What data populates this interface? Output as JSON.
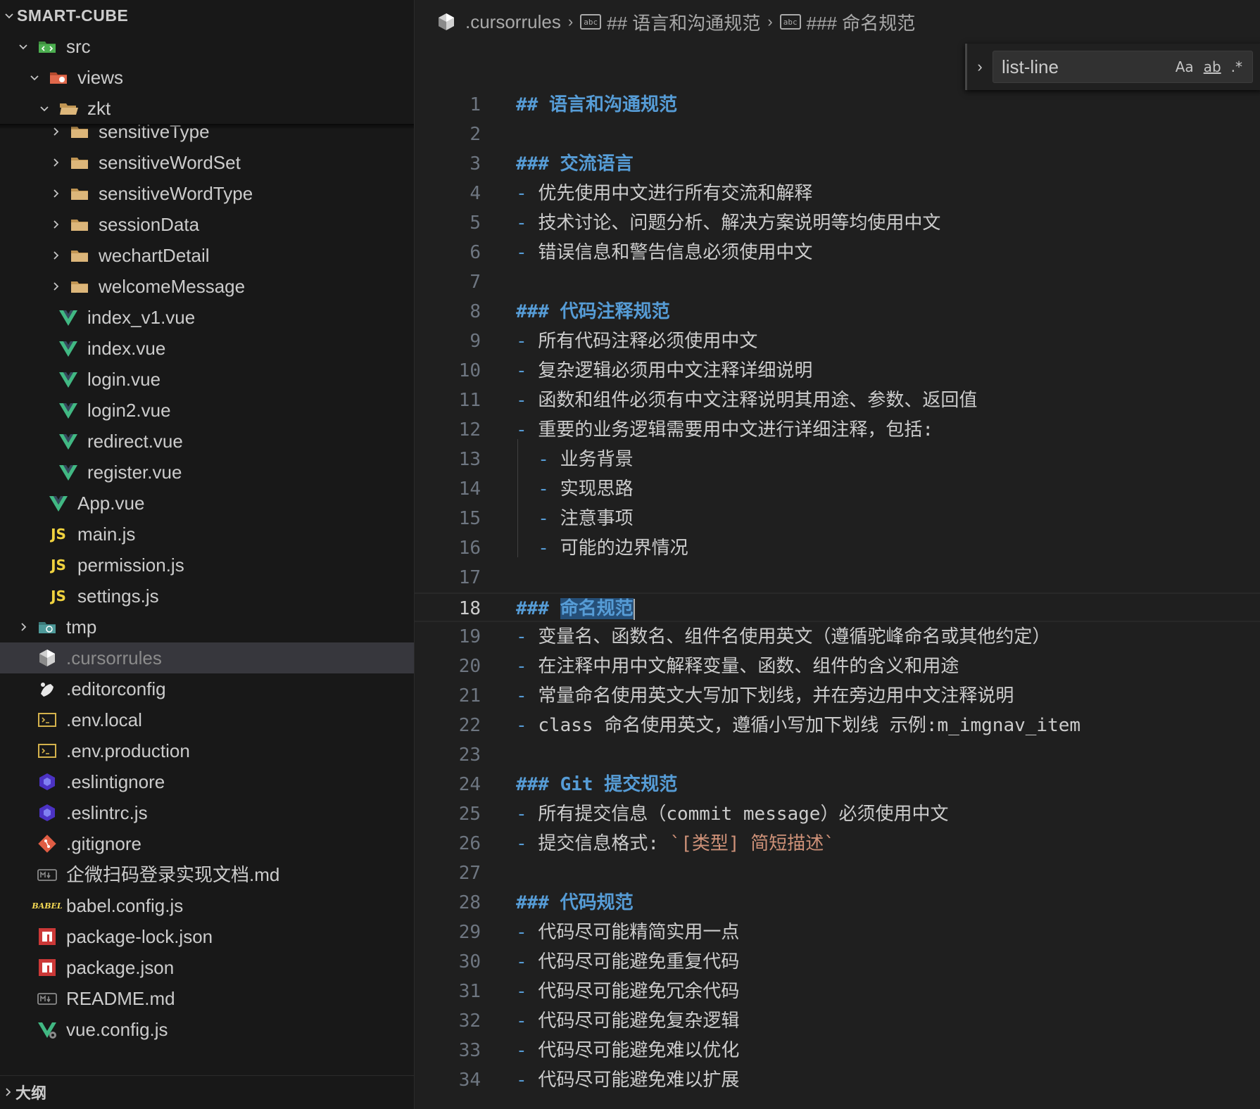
{
  "sidebar": {
    "project": "SMART-CUBE",
    "tree": [
      {
        "label": "src",
        "icon": "src-folder-icon",
        "chevron": "down",
        "depth": 1
      },
      {
        "label": "views",
        "icon": "views-folder-icon",
        "chevron": "down",
        "depth": 2
      },
      {
        "label": "zkt",
        "icon": "folder-open-icon",
        "chevron": "down",
        "depth": 3
      },
      {
        "label": "sensitiveType",
        "icon": "folder-icon",
        "chevron": "right",
        "depth": 4
      },
      {
        "label": "sensitiveWordSet",
        "icon": "folder-icon",
        "chevron": "right",
        "depth": 4
      },
      {
        "label": "sensitiveWordType",
        "icon": "folder-icon",
        "chevron": "right",
        "depth": 4
      },
      {
        "label": "sessionData",
        "icon": "folder-icon",
        "chevron": "right",
        "depth": 4
      },
      {
        "label": "wechartDetail",
        "icon": "folder-icon",
        "chevron": "right",
        "depth": 4
      },
      {
        "label": "welcomeMessage",
        "icon": "folder-icon",
        "chevron": "right",
        "depth": 4
      },
      {
        "label": "index_v1.vue",
        "icon": "vue-icon",
        "chevron": "",
        "depth": 3
      },
      {
        "label": "index.vue",
        "icon": "vue-icon",
        "chevron": "",
        "depth": 3
      },
      {
        "label": "login.vue",
        "icon": "vue-icon",
        "chevron": "",
        "depth": 3
      },
      {
        "label": "login2.vue",
        "icon": "vue-icon",
        "chevron": "",
        "depth": 3
      },
      {
        "label": "redirect.vue",
        "icon": "vue-icon",
        "chevron": "",
        "depth": 3
      },
      {
        "label": "register.vue",
        "icon": "vue-icon",
        "chevron": "",
        "depth": 3
      },
      {
        "label": "App.vue",
        "icon": "vue-icon",
        "chevron": "",
        "depth": 2
      },
      {
        "label": "main.js",
        "icon": "js-icon",
        "chevron": "",
        "depth": 2
      },
      {
        "label": "permission.js",
        "icon": "js-icon",
        "chevron": "",
        "depth": 2
      },
      {
        "label": "settings.js",
        "icon": "js-icon",
        "chevron": "",
        "depth": 2
      },
      {
        "label": "tmp",
        "icon": "tmp-folder-icon",
        "chevron": "right",
        "depth": 1
      },
      {
        "label": ".cursorrules",
        "icon": "cursor-icon",
        "chevron": "",
        "depth": 1,
        "selected": true
      },
      {
        "label": ".editorconfig",
        "icon": "editorconfig-icon",
        "chevron": "",
        "depth": 1
      },
      {
        "label": ".env.local",
        "icon": "env-icon",
        "chevron": "",
        "depth": 1
      },
      {
        "label": ".env.production",
        "icon": "env-icon",
        "chevron": "",
        "depth": 1
      },
      {
        "label": ".eslintignore",
        "icon": "eslint-icon",
        "chevron": "",
        "depth": 1
      },
      {
        "label": ".eslintrc.js",
        "icon": "eslint-icon",
        "chevron": "",
        "depth": 1
      },
      {
        "label": ".gitignore",
        "icon": "git-icon",
        "chevron": "",
        "depth": 1
      },
      {
        "label": "企微扫码登录实现文档.md",
        "icon": "markdown-icon",
        "chevron": "",
        "depth": 1
      },
      {
        "label": "babel.config.js",
        "icon": "babel-icon",
        "chevron": "",
        "depth": 1
      },
      {
        "label": "package-lock.json",
        "icon": "npm-icon",
        "chevron": "",
        "depth": 1
      },
      {
        "label": "package.json",
        "icon": "npm-icon",
        "chevron": "",
        "depth": 1
      },
      {
        "label": "README.md",
        "icon": "markdown-icon",
        "chevron": "",
        "depth": 1
      },
      {
        "label": "vue.config.js",
        "icon": "vue-config-icon",
        "chevron": "",
        "depth": 1
      }
    ],
    "outline_label": "大纲"
  },
  "breadcrumb": {
    "file": ".cursorrules",
    "section": "## 语言和沟通规范",
    "subsection": "### 命名规范"
  },
  "find": {
    "value": "list-line",
    "opt_case": "Aa",
    "opt_word": "ab",
    "opt_regex": ".*"
  },
  "editor": {
    "current_line": 18,
    "lines": [
      {
        "n": "1",
        "segs": [
          {
            "t": "## 语言和沟通规范",
            "c": "heading"
          }
        ]
      },
      {
        "n": "2",
        "segs": []
      },
      {
        "n": "3",
        "segs": [
          {
            "t": "### 交流语言",
            "c": "heading"
          }
        ]
      },
      {
        "n": "4",
        "segs": [
          {
            "t": "- ",
            "c": "dash"
          },
          {
            "t": "优先使用中文进行所有交流和解释",
            "c": ""
          }
        ]
      },
      {
        "n": "5",
        "segs": [
          {
            "t": "- ",
            "c": "dash"
          },
          {
            "t": "技术讨论、问题分析、解决方案说明等均使用中文",
            "c": ""
          }
        ]
      },
      {
        "n": "6",
        "segs": [
          {
            "t": "- ",
            "c": "dash"
          },
          {
            "t": "错误信息和警告信息必须使用中文",
            "c": ""
          }
        ]
      },
      {
        "n": "7",
        "segs": []
      },
      {
        "n": "8",
        "segs": [
          {
            "t": "### 代码注释规范",
            "c": "heading"
          }
        ]
      },
      {
        "n": "9",
        "segs": [
          {
            "t": "- ",
            "c": "dash"
          },
          {
            "t": "所有代码注释必须使用中文",
            "c": ""
          }
        ]
      },
      {
        "n": "10",
        "segs": [
          {
            "t": "- ",
            "c": "dash"
          },
          {
            "t": "复杂逻辑必须用中文注释详细说明",
            "c": ""
          }
        ]
      },
      {
        "n": "11",
        "segs": [
          {
            "t": "- ",
            "c": "dash"
          },
          {
            "t": "函数和组件必须有中文注释说明其用途、参数、返回值",
            "c": ""
          }
        ]
      },
      {
        "n": "12",
        "segs": [
          {
            "t": "- ",
            "c": "dash"
          },
          {
            "t": "重要的业务逻辑需要用中文进行详细注释，包括:",
            "c": ""
          }
        ]
      },
      {
        "n": "13",
        "segs": [
          {
            "t": "  - ",
            "c": "dash"
          },
          {
            "t": "业务背景",
            "c": ""
          }
        ]
      },
      {
        "n": "14",
        "segs": [
          {
            "t": "  - ",
            "c": "dash"
          },
          {
            "t": "实现思路",
            "c": ""
          }
        ]
      },
      {
        "n": "15",
        "segs": [
          {
            "t": "  - ",
            "c": "dash"
          },
          {
            "t": "注意事项",
            "c": ""
          }
        ]
      },
      {
        "n": "16",
        "segs": [
          {
            "t": "  - ",
            "c": "dash"
          },
          {
            "t": "可能的边界情况",
            "c": ""
          }
        ]
      },
      {
        "n": "17",
        "segs": []
      },
      {
        "n": "18",
        "segs": [
          {
            "t": "### ",
            "c": "heading"
          },
          {
            "t": "命名规范",
            "c": "heading hl"
          }
        ]
      },
      {
        "n": "19",
        "segs": [
          {
            "t": "- ",
            "c": "dash"
          },
          {
            "t": "变量名、函数名、组件名使用英文（遵循驼峰命名或其他约定）",
            "c": ""
          }
        ]
      },
      {
        "n": "20",
        "segs": [
          {
            "t": "- ",
            "c": "dash"
          },
          {
            "t": "在注释中用中文解释变量、函数、组件的含义和用途",
            "c": ""
          }
        ]
      },
      {
        "n": "21",
        "segs": [
          {
            "t": "- ",
            "c": "dash"
          },
          {
            "t": "常量命名使用英文大写加下划线，并在旁边用中文注释说明",
            "c": ""
          }
        ]
      },
      {
        "n": "22",
        "segs": [
          {
            "t": "- ",
            "c": "dash"
          },
          {
            "t": "class 命名使用英文，遵循小写加下划线 示例:m_imgnav_item",
            "c": ""
          }
        ]
      },
      {
        "n": "23",
        "segs": []
      },
      {
        "n": "24",
        "segs": [
          {
            "t": "### Git 提交规范",
            "c": "heading"
          }
        ]
      },
      {
        "n": "25",
        "segs": [
          {
            "t": "- ",
            "c": "dash"
          },
          {
            "t": "所有提交信息（commit message）必须使用中文",
            "c": ""
          }
        ]
      },
      {
        "n": "26",
        "segs": [
          {
            "t": "- ",
            "c": "dash"
          },
          {
            "t": "提交信息格式: ",
            "c": ""
          },
          {
            "t": "`[类型] 简短描述`",
            "c": "codeq"
          }
        ]
      },
      {
        "n": "27",
        "segs": []
      },
      {
        "n": "28",
        "segs": [
          {
            "t": "### 代码规范",
            "c": "heading"
          }
        ]
      },
      {
        "n": "29",
        "segs": [
          {
            "t": "- ",
            "c": "dash"
          },
          {
            "t": "代码尽可能精简实用一点",
            "c": ""
          }
        ]
      },
      {
        "n": "30",
        "segs": [
          {
            "t": "- ",
            "c": "dash"
          },
          {
            "t": "代码尽可能避免重复代码",
            "c": ""
          }
        ]
      },
      {
        "n": "31",
        "segs": [
          {
            "t": "- ",
            "c": "dash"
          },
          {
            "t": "代码尽可能避免冗余代码",
            "c": ""
          }
        ]
      },
      {
        "n": "32",
        "segs": [
          {
            "t": "- ",
            "c": "dash"
          },
          {
            "t": "代码尽可能避免复杂逻辑",
            "c": ""
          }
        ]
      },
      {
        "n": "33",
        "segs": [
          {
            "t": "- ",
            "c": "dash"
          },
          {
            "t": "代码尽可能避免难以优化",
            "c": ""
          }
        ]
      },
      {
        "n": "34",
        "segs": [
          {
            "t": "- ",
            "c": "dash"
          },
          {
            "t": "代码尽可能避免难以扩展",
            "c": ""
          }
        ]
      }
    ]
  },
  "colors": {
    "heading": "#569cd6",
    "inline_code": "#ce9178",
    "selection": "#264f78",
    "sidebar_bg": "#181818",
    "editor_bg": "#1f1f1f"
  }
}
